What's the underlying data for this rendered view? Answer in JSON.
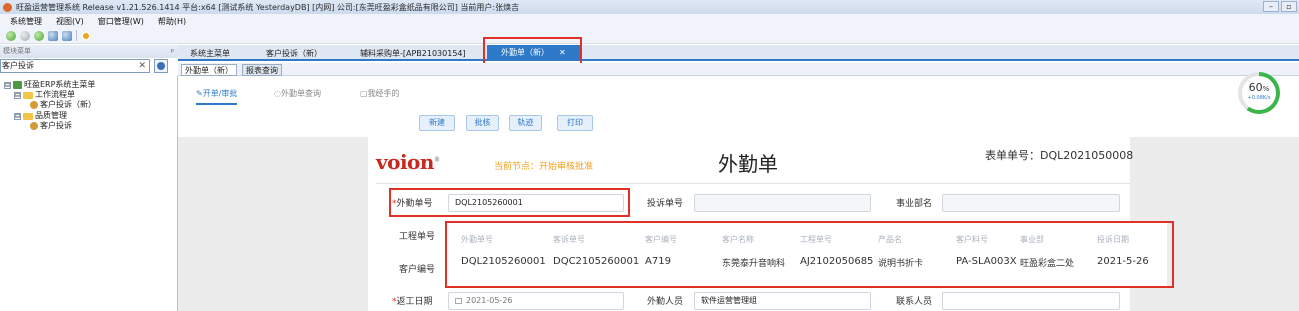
{
  "window": {
    "title": "旺盈运营管理系统 Release v1.21.526.1414 平台:x64 [测试系统 YesterdayDB] [内网] 公司:[东莞旺盈彩盒纸品有限公司] 当前用户:张焕吉",
    "minimize_label": "–",
    "restore_label": "▫"
  },
  "menu": [
    "系统管理",
    "视图(V)",
    "窗口管理(W)",
    "帮助(H)"
  ],
  "left_panel": {
    "header": "模块菜单",
    "pin": "ᵖ",
    "search_value": "客户投诉",
    "clear_label": "✕",
    "tree": [
      {
        "label": "旺盈ERP系统主菜单",
        "expander": "⊟"
      },
      {
        "label": "工作流程单",
        "expander": "⊟"
      },
      {
        "label": "客户投诉（新）",
        "expander": ""
      },
      {
        "label": "品质管理",
        "expander": "⊟"
      },
      {
        "label": "客户投诉",
        "expander": ""
      }
    ]
  },
  "tabs": {
    "items": [
      "系统主菜单",
      "客户投诉（新）",
      "辅料采购单-[APB21030154]"
    ],
    "active": "外勤单（新）",
    "close_label": "✕"
  },
  "subtabs": [
    "外勤单（新）",
    "报表查询"
  ],
  "nav": [
    "开单/审批",
    "外勤单查询",
    "我经手的"
  ],
  "actions": [
    "新建",
    "批核",
    "轨迹",
    "打印"
  ],
  "gauge": {
    "percent": 60,
    "percent_text": "60",
    "unit": "%",
    "rate": "+0.08K/s"
  },
  "form": {
    "logo": "voion",
    "logo_mark": "®",
    "status_label": "当前节点：",
    "status_value": "开始审核批准",
    "title": "外勤单",
    "number_label": "表单单号：",
    "number_value": "DQL2021050008",
    "required_mark": "*",
    "fields": {
      "waiqin_label": "外勤单号",
      "waiqin_value": "DQL2105260001",
      "complaint_label": "投诉单号",
      "complaint_value": "",
      "dept_label": "事业部名",
      "dept_value": "",
      "project_label": "工程单号",
      "customer_label": "客户编号",
      "return_date_label": "返工日期",
      "return_date_value": "2021-05-26",
      "staff_label": "外勤人员",
      "staff_value": "软件运营管理组",
      "contact_label": "联系人员",
      "contact_value": ""
    },
    "dropdown": {
      "columns": [
        "外勤单号",
        "客诉单号",
        "客户编号",
        "客户名称",
        "工程单号",
        "产品名",
        "客户料号",
        "事业部",
        "投诉日期"
      ],
      "row": [
        "DQL2105260001",
        "DQC2105260001",
        "A719",
        "东莞泰升音响科",
        "AJ2102050685",
        "说明书折卡",
        "PA-SLA003X",
        "旺盈彩盒二处",
        "2021-5-26"
      ]
    }
  }
}
